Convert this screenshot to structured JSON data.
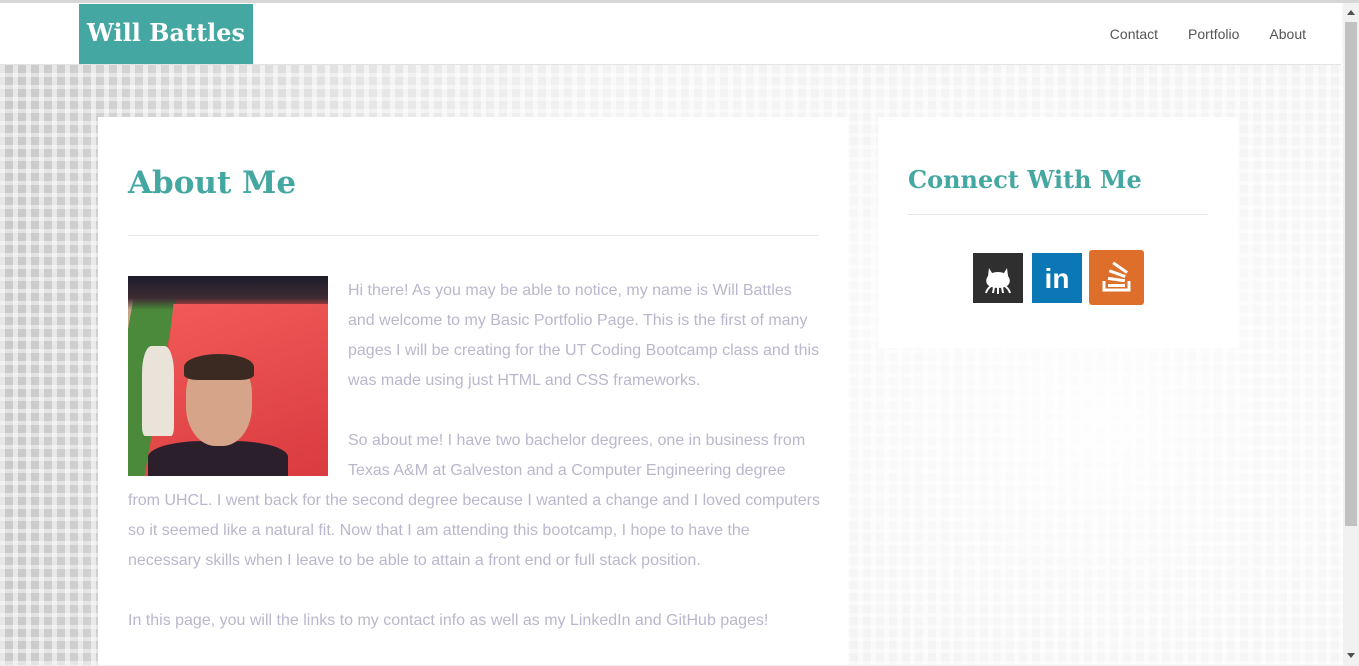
{
  "header": {
    "brand": "Will Battles",
    "nav": [
      "Contact",
      "Portfolio",
      "About"
    ]
  },
  "main": {
    "title": "About Me",
    "paragraphs": [
      "Hi there! As you may be able to notice, my name is Will Battles and welcome to my Basic Portfolio Page. This is the first of many pages I will be creating for the UT Coding Bootcamp class and this was made using just HTML and CSS frameworks.",
      "So about me! I have two bachelor degrees, one in business from Texas A&M at Galveston and a Computer Engineering degree from UHCL. I went back for the second degree because I wanted a change and I loved computers so it seemed like a natural fit. Now that I am attending this bootcamp, I hope to have the necessary skills when I leave to be able to attain a front end or full stack position.",
      "In this page, you will the links to my contact info as well as my LinkedIn and GitHub pages!"
    ]
  },
  "sidebar": {
    "title": "Connect With Me",
    "social": [
      {
        "icon": "github-icon",
        "color": "#2f2f2f"
      },
      {
        "icon": "linkedin-icon",
        "color": "#0b77b5",
        "glyph": "in"
      },
      {
        "icon": "stackoverflow-icon",
        "color": "#de6f2a"
      }
    ]
  },
  "theme": {
    "accent": "#45a7a1",
    "body_text": "#b9b7cc"
  }
}
